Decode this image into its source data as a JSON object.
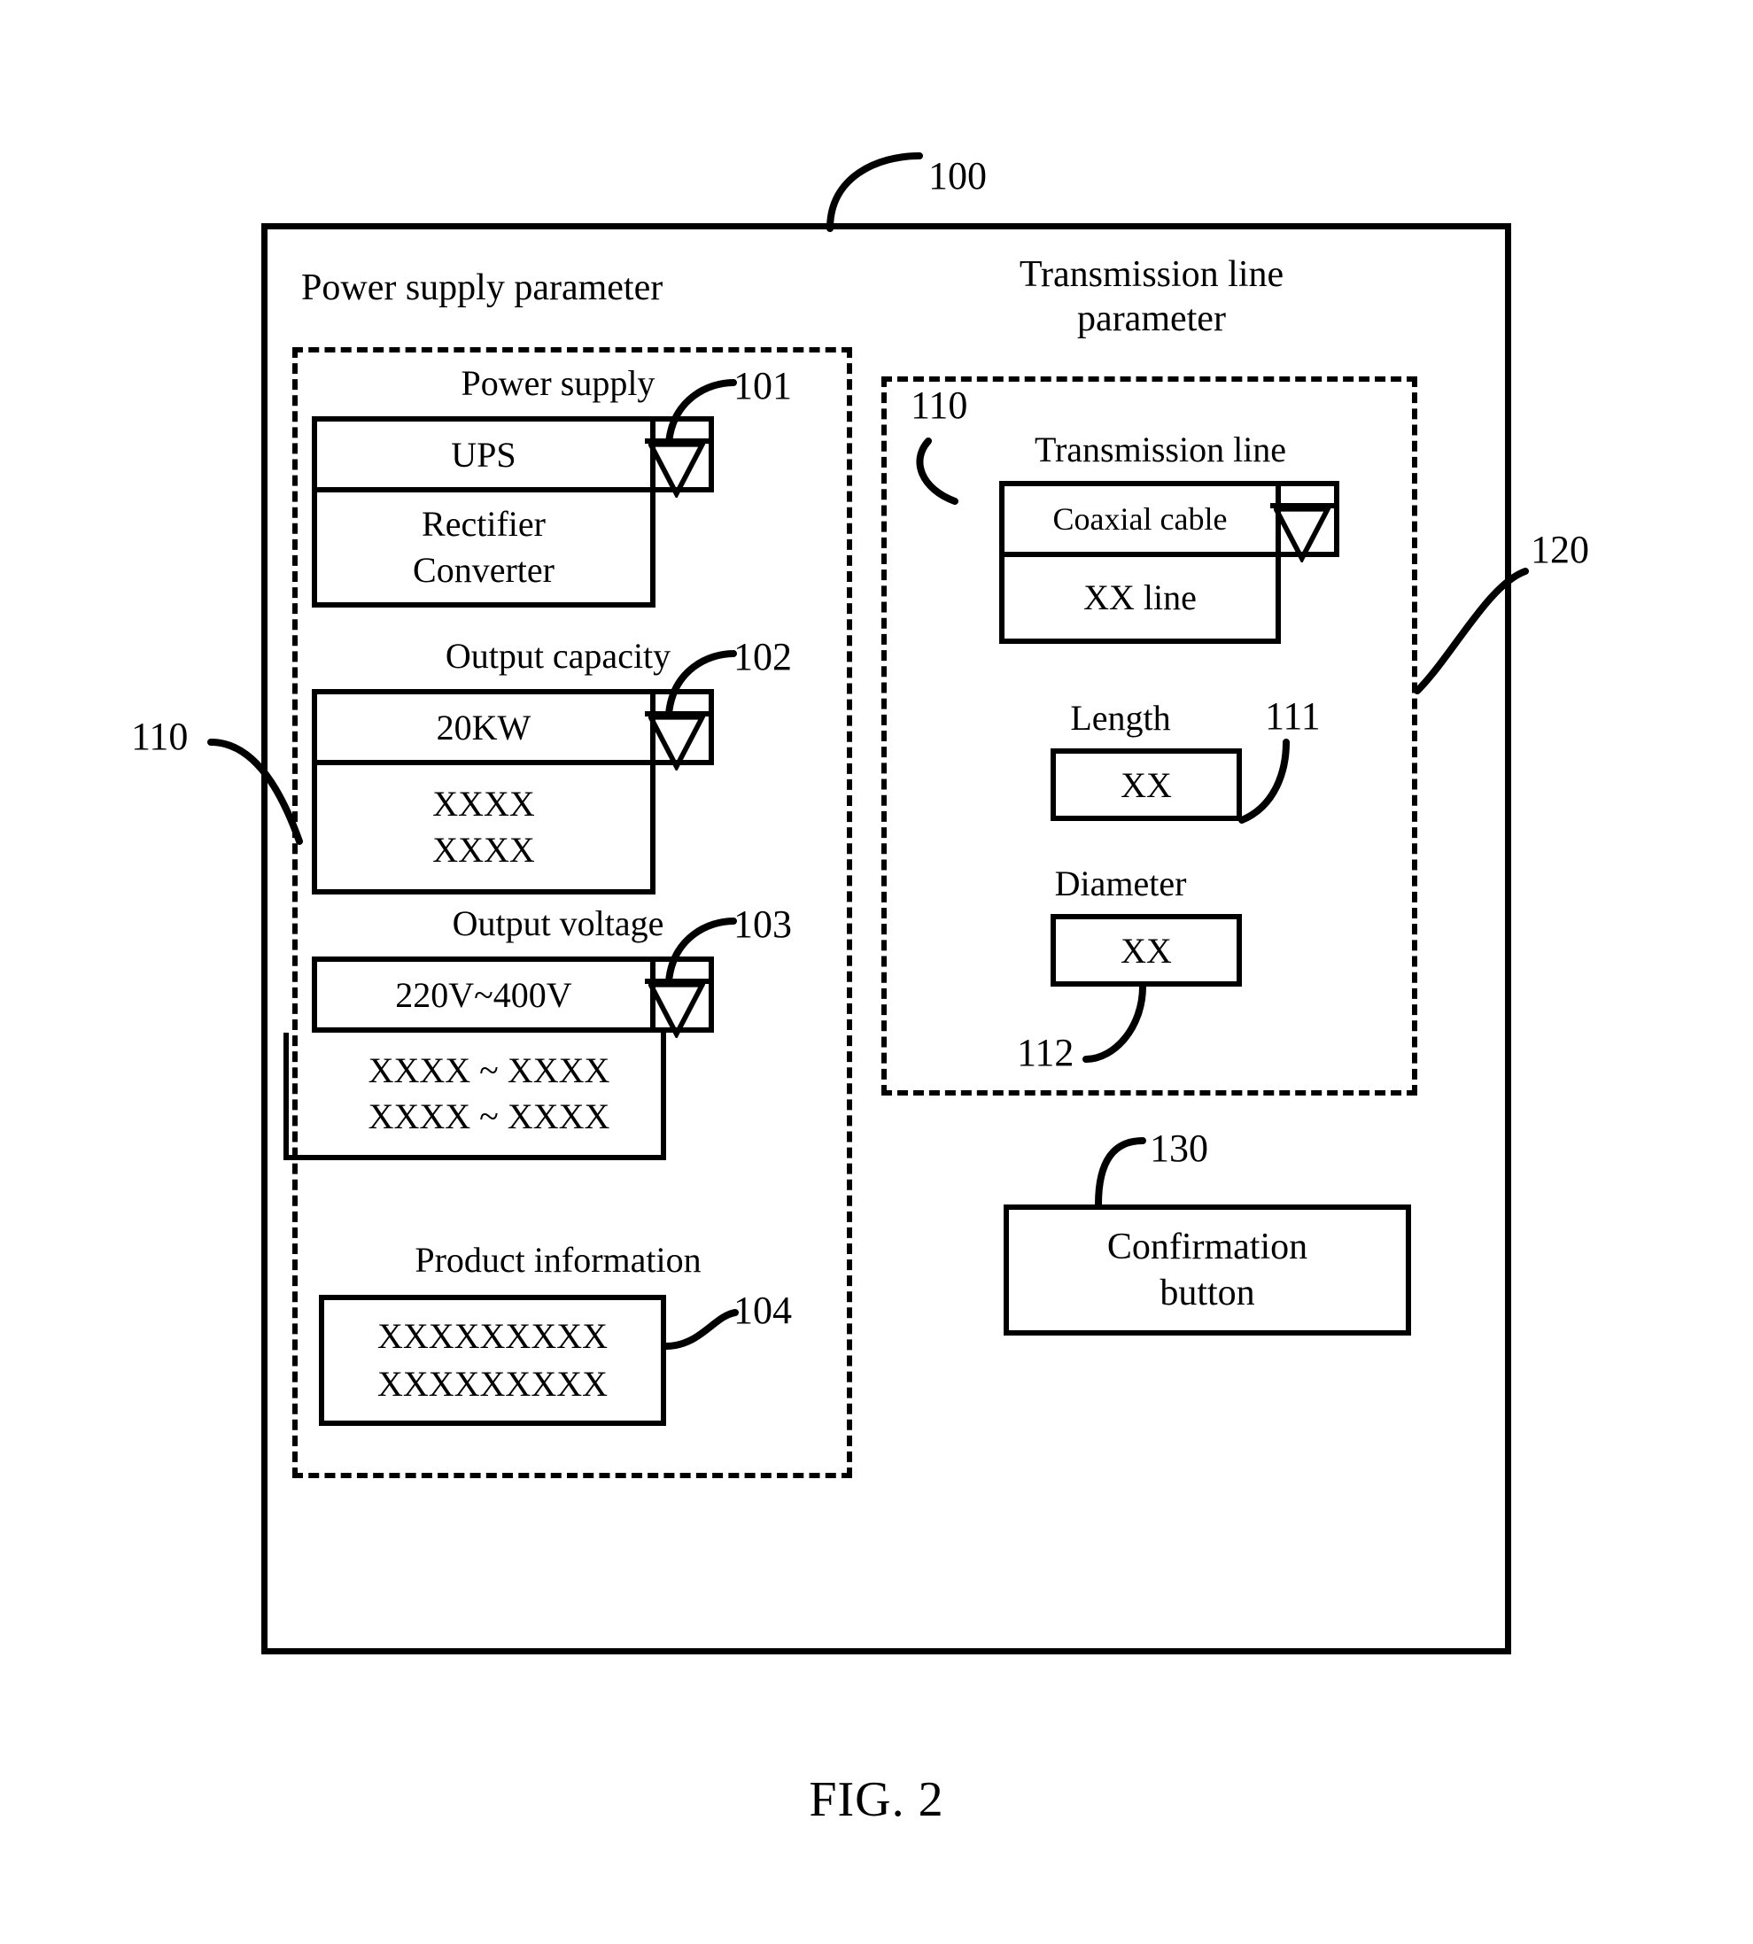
{
  "figure": {
    "caption": "FIG. 2"
  },
  "screen": {
    "ref": "100"
  },
  "power_supply_section": {
    "caption": "Power supply parameter",
    "ref": "110",
    "fields": [
      {
        "label": "Power supply",
        "ref": "101",
        "selected": "UPS",
        "options": [
          "Rectifier",
          "Converter"
        ],
        "arrow_icon": "chevron-down-icon"
      },
      {
        "label": "Output capacity",
        "ref": "102",
        "selected": "20KW",
        "options": [
          "XXXX",
          "XXXX"
        ],
        "arrow_icon": "chevron-down-icon"
      },
      {
        "label": "Output voltage",
        "ref": "103",
        "selected": "220V~400V",
        "options": [
          "XXXX ~ XXXX",
          "XXXX ~ XXXX"
        ],
        "arrow_icon": "chevron-down-icon"
      },
      {
        "label": "Product information",
        "ref": "104",
        "lines": [
          "XXXXXXXXX",
          "XXXXXXXXX"
        ]
      }
    ]
  },
  "transmission_section": {
    "caption": "Transmission line\nparameter",
    "ref": "120",
    "inner_ref": "110",
    "fields": [
      {
        "label": "Transmission line",
        "selected": "Coaxial cable",
        "options": [
          "XX line"
        ],
        "arrow_icon": "chevron-down-icon"
      },
      {
        "label": "Length",
        "ref": "111",
        "value": "XX"
      },
      {
        "label": "Diameter",
        "ref": "112",
        "value": "XX"
      }
    ]
  },
  "confirm": {
    "ref": "130",
    "label_line1": "Confirmation",
    "label_line2": "button"
  },
  "colors": {
    "stroke": "#000000",
    "background": "#ffffff"
  }
}
